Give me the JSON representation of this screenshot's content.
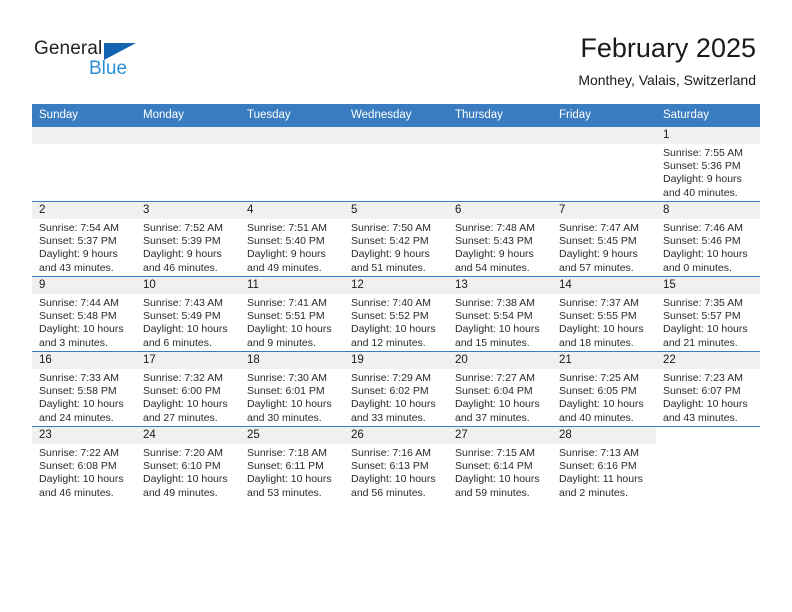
{
  "brand": {
    "name_dark": "General",
    "name_light": "Blue",
    "triangle_color": "#1263b0",
    "blue_color": "#2b8fd8"
  },
  "header": {
    "title": "February 2025",
    "subtitle": "Monthey, Valais, Switzerland"
  },
  "theme": {
    "header_blue": "#3a7cc0",
    "daynum_gray": "#f0f0f0"
  },
  "weekdays": [
    "Sunday",
    "Monday",
    "Tuesday",
    "Wednesday",
    "Thursday",
    "Friday",
    "Saturday"
  ],
  "weeks": [
    [
      {
        "day": "",
        "blank": true,
        "sunrise": "",
        "sunset": "",
        "daylight1": "",
        "daylight2": ""
      },
      {
        "day": "",
        "blank": true,
        "sunrise": "",
        "sunset": "",
        "daylight1": "",
        "daylight2": ""
      },
      {
        "day": "",
        "blank": true,
        "sunrise": "",
        "sunset": "",
        "daylight1": "",
        "daylight2": ""
      },
      {
        "day": "",
        "blank": true,
        "sunrise": "",
        "sunset": "",
        "daylight1": "",
        "daylight2": ""
      },
      {
        "day": "",
        "blank": true,
        "sunrise": "",
        "sunset": "",
        "daylight1": "",
        "daylight2": ""
      },
      {
        "day": "",
        "blank": true,
        "sunrise": "",
        "sunset": "",
        "daylight1": "",
        "daylight2": ""
      },
      {
        "day": "1",
        "blank": false,
        "sunrise": "Sunrise: 7:55 AM",
        "sunset": "Sunset: 5:36 PM",
        "daylight1": "Daylight: 9 hours",
        "daylight2": "and 40 minutes."
      }
    ],
    [
      {
        "day": "2",
        "blank": false,
        "sunrise": "Sunrise: 7:54 AM",
        "sunset": "Sunset: 5:37 PM",
        "daylight1": "Daylight: 9 hours",
        "daylight2": "and 43 minutes."
      },
      {
        "day": "3",
        "blank": false,
        "sunrise": "Sunrise: 7:52 AM",
        "sunset": "Sunset: 5:39 PM",
        "daylight1": "Daylight: 9 hours",
        "daylight2": "and 46 minutes."
      },
      {
        "day": "4",
        "blank": false,
        "sunrise": "Sunrise: 7:51 AM",
        "sunset": "Sunset: 5:40 PM",
        "daylight1": "Daylight: 9 hours",
        "daylight2": "and 49 minutes."
      },
      {
        "day": "5",
        "blank": false,
        "sunrise": "Sunrise: 7:50 AM",
        "sunset": "Sunset: 5:42 PM",
        "daylight1": "Daylight: 9 hours",
        "daylight2": "and 51 minutes."
      },
      {
        "day": "6",
        "blank": false,
        "sunrise": "Sunrise: 7:48 AM",
        "sunset": "Sunset: 5:43 PM",
        "daylight1": "Daylight: 9 hours",
        "daylight2": "and 54 minutes."
      },
      {
        "day": "7",
        "blank": false,
        "sunrise": "Sunrise: 7:47 AM",
        "sunset": "Sunset: 5:45 PM",
        "daylight1": "Daylight: 9 hours",
        "daylight2": "and 57 minutes."
      },
      {
        "day": "8",
        "blank": false,
        "sunrise": "Sunrise: 7:46 AM",
        "sunset": "Sunset: 5:46 PM",
        "daylight1": "Daylight: 10 hours",
        "daylight2": "and 0 minutes."
      }
    ],
    [
      {
        "day": "9",
        "blank": false,
        "sunrise": "Sunrise: 7:44 AM",
        "sunset": "Sunset: 5:48 PM",
        "daylight1": "Daylight: 10 hours",
        "daylight2": "and 3 minutes."
      },
      {
        "day": "10",
        "blank": false,
        "sunrise": "Sunrise: 7:43 AM",
        "sunset": "Sunset: 5:49 PM",
        "daylight1": "Daylight: 10 hours",
        "daylight2": "and 6 minutes."
      },
      {
        "day": "11",
        "blank": false,
        "sunrise": "Sunrise: 7:41 AM",
        "sunset": "Sunset: 5:51 PM",
        "daylight1": "Daylight: 10 hours",
        "daylight2": "and 9 minutes."
      },
      {
        "day": "12",
        "blank": false,
        "sunrise": "Sunrise: 7:40 AM",
        "sunset": "Sunset: 5:52 PM",
        "daylight1": "Daylight: 10 hours",
        "daylight2": "and 12 minutes."
      },
      {
        "day": "13",
        "blank": false,
        "sunrise": "Sunrise: 7:38 AM",
        "sunset": "Sunset: 5:54 PM",
        "daylight1": "Daylight: 10 hours",
        "daylight2": "and 15 minutes."
      },
      {
        "day": "14",
        "blank": false,
        "sunrise": "Sunrise: 7:37 AM",
        "sunset": "Sunset: 5:55 PM",
        "daylight1": "Daylight: 10 hours",
        "daylight2": "and 18 minutes."
      },
      {
        "day": "15",
        "blank": false,
        "sunrise": "Sunrise: 7:35 AM",
        "sunset": "Sunset: 5:57 PM",
        "daylight1": "Daylight: 10 hours",
        "daylight2": "and 21 minutes."
      }
    ],
    [
      {
        "day": "16",
        "blank": false,
        "sunrise": "Sunrise: 7:33 AM",
        "sunset": "Sunset: 5:58 PM",
        "daylight1": "Daylight: 10 hours",
        "daylight2": "and 24 minutes."
      },
      {
        "day": "17",
        "blank": false,
        "sunrise": "Sunrise: 7:32 AM",
        "sunset": "Sunset: 6:00 PM",
        "daylight1": "Daylight: 10 hours",
        "daylight2": "and 27 minutes."
      },
      {
        "day": "18",
        "blank": false,
        "sunrise": "Sunrise: 7:30 AM",
        "sunset": "Sunset: 6:01 PM",
        "daylight1": "Daylight: 10 hours",
        "daylight2": "and 30 minutes."
      },
      {
        "day": "19",
        "blank": false,
        "sunrise": "Sunrise: 7:29 AM",
        "sunset": "Sunset: 6:02 PM",
        "daylight1": "Daylight: 10 hours",
        "daylight2": "and 33 minutes."
      },
      {
        "day": "20",
        "blank": false,
        "sunrise": "Sunrise: 7:27 AM",
        "sunset": "Sunset: 6:04 PM",
        "daylight1": "Daylight: 10 hours",
        "daylight2": "and 37 minutes."
      },
      {
        "day": "21",
        "blank": false,
        "sunrise": "Sunrise: 7:25 AM",
        "sunset": "Sunset: 6:05 PM",
        "daylight1": "Daylight: 10 hours",
        "daylight2": "and 40 minutes."
      },
      {
        "day": "22",
        "blank": false,
        "sunrise": "Sunrise: 7:23 AM",
        "sunset": "Sunset: 6:07 PM",
        "daylight1": "Daylight: 10 hours",
        "daylight2": "and 43 minutes."
      }
    ],
    [
      {
        "day": "23",
        "blank": false,
        "sunrise": "Sunrise: 7:22 AM",
        "sunset": "Sunset: 6:08 PM",
        "daylight1": "Daylight: 10 hours",
        "daylight2": "and 46 minutes."
      },
      {
        "day": "24",
        "blank": false,
        "sunrise": "Sunrise: 7:20 AM",
        "sunset": "Sunset: 6:10 PM",
        "daylight1": "Daylight: 10 hours",
        "daylight2": "and 49 minutes."
      },
      {
        "day": "25",
        "blank": false,
        "sunrise": "Sunrise: 7:18 AM",
        "sunset": "Sunset: 6:11 PM",
        "daylight1": "Daylight: 10 hours",
        "daylight2": "and 53 minutes."
      },
      {
        "day": "26",
        "blank": false,
        "sunrise": "Sunrise: 7:16 AM",
        "sunset": "Sunset: 6:13 PM",
        "daylight1": "Daylight: 10 hours",
        "daylight2": "and 56 minutes."
      },
      {
        "day": "27",
        "blank": false,
        "sunrise": "Sunrise: 7:15 AM",
        "sunset": "Sunset: 6:14 PM",
        "daylight1": "Daylight: 10 hours",
        "daylight2": "and 59 minutes."
      },
      {
        "day": "28",
        "blank": false,
        "sunrise": "Sunrise: 7:13 AM",
        "sunset": "Sunset: 6:16 PM",
        "daylight1": "Daylight: 11 hours",
        "daylight2": "and 2 minutes."
      },
      {
        "day": "",
        "blank": true,
        "sunrise": "",
        "sunset": "",
        "daylight1": "",
        "daylight2": ""
      }
    ]
  ]
}
